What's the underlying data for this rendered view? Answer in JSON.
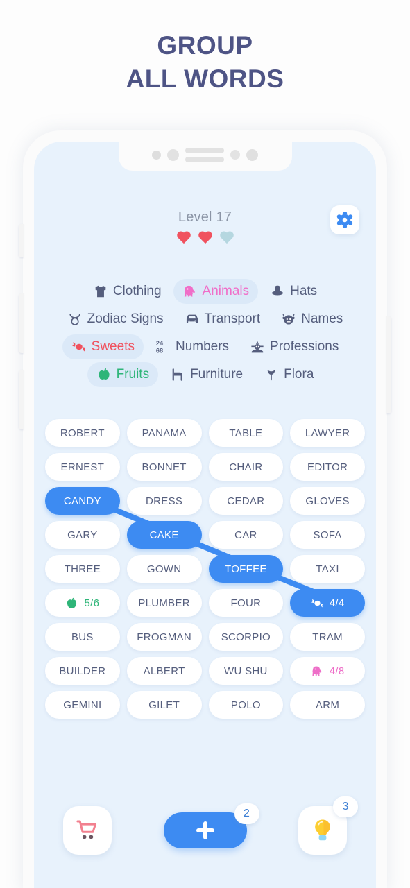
{
  "headline": {
    "line1": "GROUP",
    "line2": "ALL WORDS",
    "color": "#4e5485"
  },
  "header": {
    "level_label": "Level 17",
    "hearts": [
      {
        "state": "full",
        "name": "heart-full"
      },
      {
        "state": "full",
        "name": "heart-full"
      },
      {
        "state": "empty",
        "name": "heart-empty"
      }
    ],
    "settings_icon": "gear-icon",
    "accent_color": "#3d8bf2",
    "heart_color": "#f0525f",
    "heart_empty_color": "#b5d7e0"
  },
  "categories": [
    [
      {
        "label": "Clothing",
        "icon": "tshirt-icon",
        "active": false,
        "color": "#555e7d"
      },
      {
        "label": "Animals",
        "icon": "elephant-icon",
        "active": true,
        "color": "#f06ec8"
      },
      {
        "label": "Hats",
        "icon": "hat-icon",
        "active": false,
        "color": "#555e7d"
      }
    ],
    [
      {
        "label": "Zodiac Signs",
        "icon": "taurus-icon",
        "active": false,
        "color": "#555e7d"
      },
      {
        "label": "Transport",
        "icon": "car-icon",
        "active": false,
        "color": "#555e7d"
      },
      {
        "label": "Names",
        "icon": "face-icon",
        "active": false,
        "color": "#555e7d"
      }
    ],
    [
      {
        "label": "Sweets",
        "icon": "candy-icon",
        "active": true,
        "color": "#f0525f"
      },
      {
        "label": "Numbers",
        "icon": "numbers-icon",
        "active": false,
        "color": "#555e7d"
      },
      {
        "label": "Professions",
        "icon": "worker-icon",
        "active": false,
        "color": "#555e7d"
      }
    ],
    [
      {
        "label": "Fruits",
        "icon": "apple-icon",
        "active": true,
        "color": "#2eb578"
      },
      {
        "label": "Furniture",
        "icon": "chair-icon",
        "active": false,
        "color": "#555e7d"
      },
      {
        "label": "Flora",
        "icon": "tulip-icon",
        "active": false,
        "color": "#555e7d"
      }
    ]
  ],
  "grid": [
    {
      "label": "ROBERT",
      "selected": false,
      "icon": null
    },
    {
      "label": "PANAMA",
      "selected": false,
      "icon": null
    },
    {
      "label": "TABLE",
      "selected": false,
      "icon": null
    },
    {
      "label": "LAWYER",
      "selected": false,
      "icon": null
    },
    {
      "label": "ERNEST",
      "selected": false,
      "icon": null
    },
    {
      "label": "BONNET",
      "selected": false,
      "icon": null
    },
    {
      "label": "CHAIR",
      "selected": false,
      "icon": null
    },
    {
      "label": "EDITOR",
      "selected": false,
      "icon": null
    },
    {
      "label": "CANDY",
      "selected": true,
      "icon": null
    },
    {
      "label": "DRESS",
      "selected": false,
      "icon": null
    },
    {
      "label": "CEDAR",
      "selected": false,
      "icon": null
    },
    {
      "label": "GLOVES",
      "selected": false,
      "icon": null
    },
    {
      "label": "GARY",
      "selected": false,
      "icon": null
    },
    {
      "label": "CAKE",
      "selected": true,
      "icon": null
    },
    {
      "label": "CAR",
      "selected": false,
      "icon": null
    },
    {
      "label": "SOFA",
      "selected": false,
      "icon": null
    },
    {
      "label": "THREE",
      "selected": false,
      "icon": null
    },
    {
      "label": "GOWN",
      "selected": false,
      "icon": null
    },
    {
      "label": "TOFFEE",
      "selected": true,
      "icon": null
    },
    {
      "label": "TAXI",
      "selected": false,
      "icon": null
    },
    {
      "label": "5/6",
      "selected": false,
      "icon": "apple-icon",
      "counter": true,
      "counter_color": "green"
    },
    {
      "label": "PLUMBER",
      "selected": false,
      "icon": null
    },
    {
      "label": "FOUR",
      "selected": false,
      "icon": null
    },
    {
      "label": "4/4",
      "selected": true,
      "icon": "candy-icon",
      "counter": true,
      "counter_color": "white"
    },
    {
      "label": "BUS",
      "selected": false,
      "icon": null
    },
    {
      "label": "FROGMAN",
      "selected": false,
      "icon": null
    },
    {
      "label": "SCORPIO",
      "selected": false,
      "icon": null
    },
    {
      "label": "TRAM",
      "selected": false,
      "icon": null
    },
    {
      "label": "BUILDER",
      "selected": false,
      "icon": null
    },
    {
      "label": "ALBERT",
      "selected": false,
      "icon": null
    },
    {
      "label": "WU SHU",
      "selected": false,
      "icon": null
    },
    {
      "label": "4/8",
      "selected": false,
      "icon": "elephant-icon",
      "counter": true,
      "counter_color": "pink"
    },
    {
      "label": "GEMINI",
      "selected": false,
      "icon": null
    },
    {
      "label": "GILET",
      "selected": false,
      "icon": null
    },
    {
      "label": "POLO",
      "selected": false,
      "icon": null
    },
    {
      "label": "ARM",
      "selected": false,
      "icon": null
    }
  ],
  "connections": [
    {
      "from": "CANDY",
      "to": "CAKE"
    },
    {
      "from": "CAKE",
      "to": "TOFFEE"
    },
    {
      "from": "TOFFEE",
      "to": "4/4"
    }
  ],
  "bottom": {
    "shop_icon": "shopping-cart-icon",
    "add_icon": "plus-icon",
    "add_badge": "2",
    "hint_icon": "lightbulb-icon",
    "hint_badge": "3"
  }
}
